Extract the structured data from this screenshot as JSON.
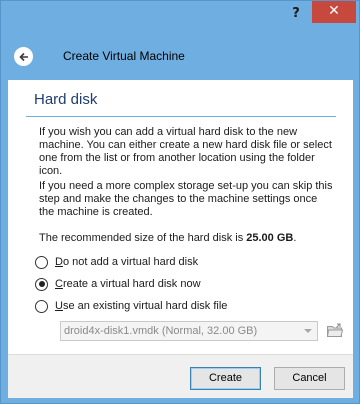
{
  "window": {
    "help_label": "?",
    "close_label": "✕"
  },
  "header": {
    "title": "Create Virtual Machine",
    "back_icon": "back-arrow-icon"
  },
  "page": {
    "title": "Hard disk",
    "paragraph1": "If you wish you can add a virtual hard disk to the new machine. You can either create a new hard disk file or select one from the list or from another location using the folder icon.",
    "paragraph2": "If you need a more complex storage set-up you can skip this step and make the changes to the machine settings once the machine is created.",
    "recommended_prefix": "The recommended size of the hard disk is ",
    "recommended_size": "25.00 GB",
    "recommended_suffix": "."
  },
  "options": [
    {
      "label_accel": "D",
      "label_rest": "o not add a virtual hard disk",
      "checked": false
    },
    {
      "label_accel": "C",
      "label_rest": "reate a virtual hard disk now",
      "checked": true
    },
    {
      "label_accel": "U",
      "label_rest": "se an existing virtual hard disk file",
      "checked": false
    }
  ],
  "existing_disk": {
    "selected": "droid4x-disk1.vmdk (Normal, 32.00 GB)",
    "enabled": false
  },
  "footer": {
    "create_label": "Create",
    "cancel_label": "Cancel"
  },
  "colors": {
    "accent": "#6eaee0",
    "title": "#1f3d6f",
    "close": "#c7483c"
  }
}
